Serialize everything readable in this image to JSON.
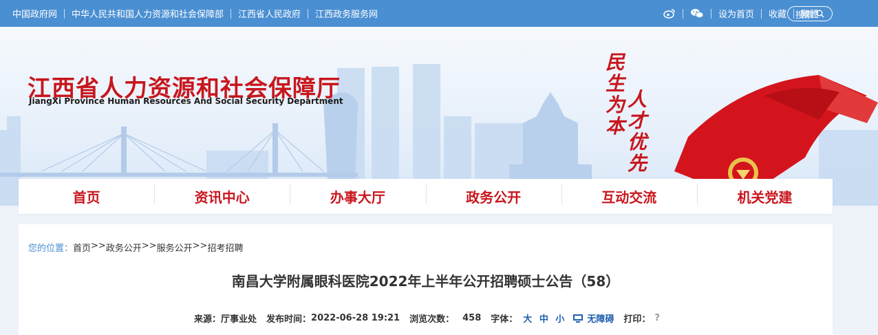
{
  "topbar": {
    "links": [
      "中国政府网",
      "中华人民共和国人力资源和社会保障部",
      "江西省人民政府",
      "江西政务服务网"
    ],
    "icons": [
      "weibo-icon",
      "wechat-icon"
    ],
    "right_links": [
      "设为首页",
      "收藏",
      "繁體"
    ],
    "search_label": "搜索"
  },
  "brand": {
    "name_cn": "江西省人力资源和社会保障厅",
    "name_en": "JiangXi Province Human Resources And Social Security Department",
    "slogan_left": "民生为本",
    "slogan_right": "人才优先"
  },
  "nav": {
    "items": [
      "首页",
      "资讯中心",
      "办事大厅",
      "政务公开",
      "互动交流",
      "机关党建"
    ]
  },
  "breadcrumb": {
    "label": "您的位置：",
    "items": [
      "首页",
      "政务公开",
      "服务公开",
      "招考招聘"
    ],
    "separator": ">>"
  },
  "article": {
    "title": "南昌大学附属眼科医院2022年上半年公开招聘硕士公告（58）",
    "source_label": "来源：",
    "source": "厅事业处",
    "time_label": "发布时间：",
    "time": "2022-06-28 19:21",
    "views_label": "浏览次数：",
    "views": "458",
    "font_label": "字体：",
    "font_sizes": [
      "大",
      "中",
      "小"
    ],
    "accessibility": "无障碍",
    "print_label": "打印：",
    "print_icon": "?"
  },
  "colors": {
    "brand_red": "#c8161d",
    "topbar_blue": "#4a8fd2",
    "link_blue": "#1f5fb0"
  }
}
